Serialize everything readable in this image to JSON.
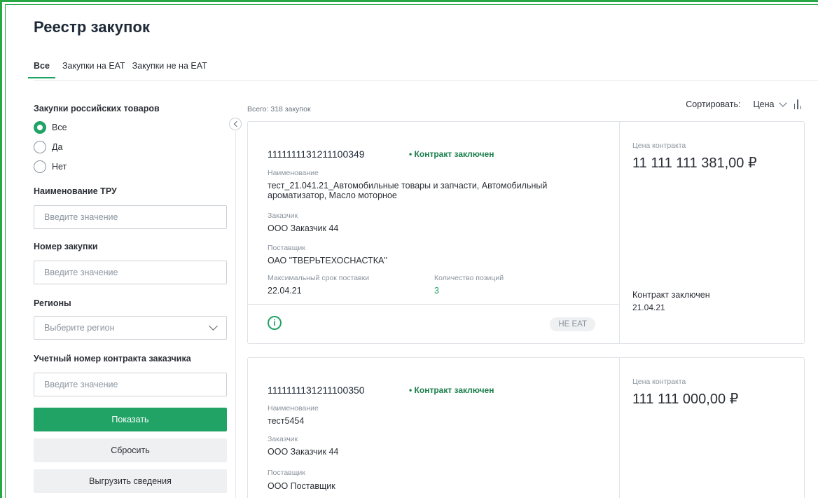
{
  "page": {
    "title": "Реестр закупок"
  },
  "tabs": [
    {
      "label": "Все",
      "active": true
    },
    {
      "label": "Закупки на ЕАТ",
      "active": false
    },
    {
      "label": "Закупки не на ЕАТ",
      "active": false
    }
  ],
  "filters": {
    "russian_goods": {
      "label": "Закупки российских товаров",
      "options": [
        {
          "label": "Все",
          "selected": true
        },
        {
          "label": "Да",
          "selected": false
        },
        {
          "label": "Нет",
          "selected": false
        }
      ]
    },
    "tru_name": {
      "label": "Наименование ТРУ",
      "placeholder": "Введите значение"
    },
    "purchase_number": {
      "label": "Номер закупки",
      "placeholder": "Введите значение"
    },
    "regions": {
      "label": "Регионы",
      "placeholder": "Выберите регион"
    },
    "contract_number": {
      "label": "Учетный номер контракта заказчика",
      "placeholder": "Введите значение"
    },
    "show_button": "Показать",
    "reset_button": "Сбросить",
    "export_button": "Выгрузить сведения"
  },
  "results": {
    "total": "Всего: 318 закупок",
    "sort_label": "Сортировать:",
    "sort_value": "Цена"
  },
  "cards": [
    {
      "number": "1111111131211100349",
      "status": "• Контракт заключен",
      "name_caption": "Наименование",
      "name": "тест_21.041.21_Автомобильные товары и запчасти, Автомобильный ароматизатор, Масло моторное",
      "customer_caption": "Заказчик",
      "customer": "ООО Заказчик 44",
      "supplier_caption": "Поставщик",
      "supplier": "ОАО \"ТВЕРЬТЕХОСНАСТКА\"",
      "delivery_caption": "Максимальный срок поставки",
      "delivery": "22.04.21",
      "positions_caption": "Количество позиций",
      "positions": "3",
      "price_caption": "Цена контракта",
      "price": "11 111 111 381,00 ₽",
      "contract_status": "Контракт заключен",
      "contract_date": "21.04.21",
      "badge": "НЕ ЕАТ"
    },
    {
      "number": "1111111131211100350",
      "status": "• Контракт заключен",
      "name_caption": "Наименование",
      "name": "тест5454",
      "customer_caption": "Заказчик",
      "customer": "ООО Заказчик 44",
      "supplier_caption": "Поставщик",
      "supplier": "ООО Поставщик",
      "price_caption": "Цена контракта",
      "price": "111 111 000,00 ₽"
    }
  ],
  "colors": {
    "accent": "#21a366",
    "frame": "#27a844"
  },
  "icons": [
    "info-icon",
    "chevron-left-icon",
    "chevron-down-icon",
    "sort-bars-icon"
  ]
}
